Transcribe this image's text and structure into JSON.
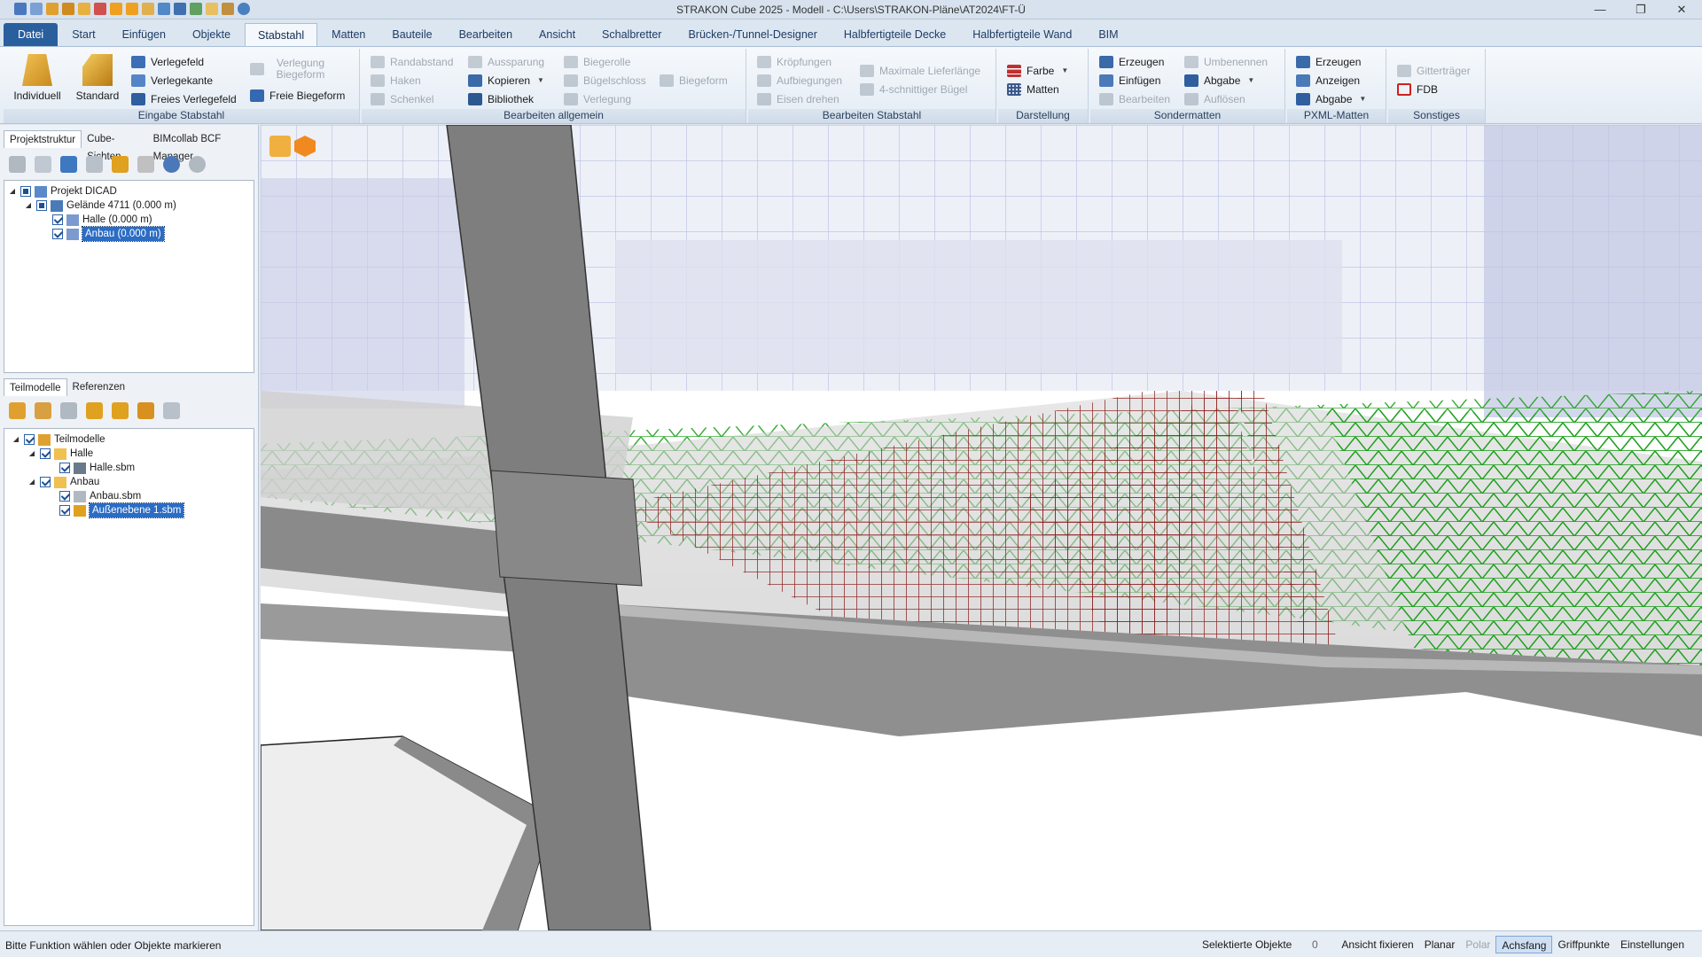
{
  "app": {
    "title": "STRAKON Cube 2025 - Modell - C:\\Users\\STRAKON-Pläne\\AT2024\\FT-Ü",
    "window_controls": [
      "—",
      "❐",
      "✕"
    ]
  },
  "menu": {
    "tabs": [
      "Datei",
      "Start",
      "Einfügen",
      "Objekte",
      "Stabstahl",
      "Matten",
      "Bauteile",
      "Bearbeiten",
      "Ansicht",
      "Schalbretter",
      "Brücken-/Tunnel-Designer",
      "Halbfertigteile Decke",
      "Halbfertigteile Wand",
      "BIM"
    ],
    "active": "Stabstahl"
  },
  "ribbon": {
    "eingabe": {
      "label": "Eingabe Stabstahl",
      "individuell": "Individuell",
      "standard": "Standard",
      "verlegefeld": "Verlegefeld",
      "verlegekante": "Verlegekante",
      "freies_verlegefeld": "Freies Verlegefeld",
      "verlegung_biegeform": "Verlegung Biegeform",
      "freie_biegeform": "Freie Biegeform"
    },
    "bearbeiten": {
      "label": "Bearbeiten allgemein",
      "randabstand": "Randabstand",
      "haken": "Haken",
      "schenkel": "Schenkel",
      "aussparung": "Aussparung",
      "kopieren": "Kopieren",
      "bibliothek": "Bibliothek",
      "biegerolle": "Biegerolle",
      "buegelschloss": "Bügelschloss",
      "verlegung": "Verlegung",
      "biegeform": "Biegeform"
    },
    "bearbeiten_stab": {
      "label": "Bearbeiten Stabstahl",
      "kroepfungen": "Kröpfungen",
      "aufbiegungen": "Aufbiegungen",
      "eisen_drehen": "Eisen drehen",
      "max_lieferlaenge": "Maximale Lieferlänge",
      "schnittiger_buegel": "4-schnittiger Bügel"
    },
    "darstellung": {
      "label": "Darstellung",
      "farbe": "Farbe",
      "matten": "Matten"
    },
    "sondermatten": {
      "label": "Sondermatten",
      "erzeugen": "Erzeugen",
      "einfuegen": "Einfügen",
      "bearbeiten": "Bearbeiten",
      "umbenennen": "Umbenennen",
      "abgabe": "Abgabe",
      "aufloesen": "Auflösen"
    },
    "pxml": {
      "label": "PXML-Matten",
      "erzeugen": "Erzeugen",
      "anzeigen": "Anzeigen",
      "abgabe": "Abgabe"
    },
    "sonstiges": {
      "label": "Sonstiges",
      "gittertraeger": "Gitterträger",
      "fdb": "FDB"
    }
  },
  "left_panel": {
    "top_tabs": [
      "Projektstruktur",
      "Cube-Sichten",
      "BIMcollab BCF Manager"
    ],
    "tree": {
      "projekt": "Projekt DICAD",
      "gelaende": "Gelände 4711 (0.000 m)",
      "halle": "Halle (0.000 m)",
      "anbau": "Anbau (0.000 m)"
    },
    "bottom_tabs": [
      "Teilmodelle",
      "Referenzen"
    ],
    "tree2": {
      "teilmodelle": "Teilmodelle",
      "halle": "Halle",
      "halle_sbm": "Halle.sbm",
      "anbau": "Anbau",
      "anbau_sbm": "Anbau.sbm",
      "aussenebene": "Außenebene 1.sbm"
    }
  },
  "colors": {
    "mesh_green": "#1fa01f",
    "rebar_red": "#8b1a1a",
    "concrete": "#8f8f8f",
    "ghost_blue": "#9aa6d8",
    "accent": "#2b6cc4"
  },
  "statusbar": {
    "message": "Bitte Funktion wählen oder Objekte markieren",
    "selected_label": "Selektierte Objekte",
    "selected_count": "0",
    "ansicht_fixieren": "Ansicht fixieren",
    "planar": "Planar",
    "polar": "Polar",
    "achsfang": "Achsfang",
    "griffpunkte": "Griffpunkte",
    "einstellungen": "Einstellungen"
  }
}
